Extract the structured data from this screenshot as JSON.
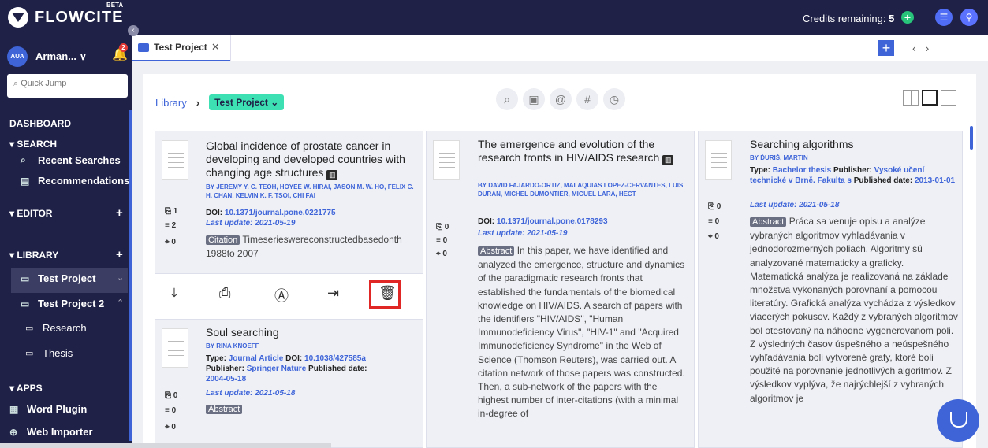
{
  "topbar": {
    "logo": "FLOWCITE",
    "beta": "BETA",
    "credits_label": "Credits remaining:",
    "credits_value": "5"
  },
  "sidebar": {
    "avatar": "AUA",
    "user": "Arman... ∨",
    "notifications": "2",
    "quick_jump": "Quick Jump",
    "dashboard": "DASHBOARD",
    "search": "▾ SEARCH",
    "recent_searches": "Recent Searches",
    "recommendations": "Recommendations",
    "editor": "▾ EDITOR",
    "library": "▾ LIBRARY",
    "project1": "Test Project",
    "project2": "Test Project 2",
    "research": "Research",
    "thesis": "Thesis",
    "apps": "▾ APPS",
    "word_plugin": "Word Plugin",
    "web_importer": "Web Importer"
  },
  "tabs": {
    "active": "Test Project"
  },
  "breadcrumb": {
    "library": "Library",
    "project": "Test Project ⌄"
  },
  "cards": [
    {
      "title": "Global incidence of prostate cancer in developing and developed countries with changing age structures",
      "authors": "BY JEREMY Y. C. TEOH, HOYEE W. HIRAI, JASON M. W. HO, FELIX C. H. CHAN, KELVIN K. F. TSOI, CHI FAI",
      "doi_label": "DOI:",
      "doi": "10.1371/journal.pone.0221775",
      "update": "Last update: 2021-05-19",
      "tag": "Citation",
      "body": "Timeserieswereconstructedbasedonth 1988to 2007",
      "stat1": "1",
      "stat2": "2",
      "stat3": "0"
    },
    {
      "title": "Soul searching",
      "authors": "BY RINA KNOEFF",
      "type_label": "Type:",
      "type": "Journal Article",
      "doi_label": "DOI:",
      "doi": "10.1038/427585a",
      "publisher_label": "Publisher:",
      "publisher": "Springer Nature",
      "pub_date_label": "Published date:",
      "pub_date": "2004-05-18",
      "update": "Last update: 2021-05-18",
      "tag": "Abstract",
      "stat1": "0",
      "stat2": "0",
      "stat3": "0"
    },
    {
      "title": "The emergence and evolution of the research fronts in HIV/AIDS research",
      "authors": "BY DAVID FAJARDO-ORTIZ, MALAQUIAS LOPEZ-CERVANTES, LUIS DURAN, MICHEL DUMONTIER, MIGUEL LARA, HECT",
      "doi_label": "DOI:",
      "doi": "10.1371/journal.pone.0178293",
      "update": "Last update: 2021-05-19",
      "tag": "Abstract",
      "body": "In this paper, we have identified and analyzed the emergence, structure and dynamics of the paradigmatic research fronts that established the fundamentals of the biomedical knowledge on HIV/AIDS. A search of papers with the identifiers \"HIV/AIDS\", \"Human Immunodeficiency Virus\", \"HIV-1\" and \"Acquired Immunodeficiency Syndrome\" in the Web of Science (Thomson Reuters), was carried out. A citation network of those papers was constructed. Then, a sub-network of the papers with the highest number of inter-citations (with a minimal in-degree of",
      "stat1": "0",
      "stat2": "0",
      "stat3": "0"
    },
    {
      "title": "Searching algorithms",
      "authors": "BY ĎURIŠ, MARTIN",
      "type_label": "Type:",
      "type": "Bachelor thesis",
      "publisher_label": "Publisher:",
      "publisher": "Vysoké učení technické v Brně. Fakulta s",
      "pub_date_label": "Published date:",
      "pub_date": "2013-01-01",
      "update": "Last update: 2021-05-18",
      "tag": "Abstract",
      "body": "Práca sa venuje opisu a analýze vybraných algoritmov vyhľadávania v jednodorozmerných poliach. Algoritmy sú analyzované matematicky a graficky. Matematická analýza je realizovaná na základe množstva vykonaných porovnaní a pomocou literatúry. Grafická analýza vychádza z výsledkov viacerých pokusov. Každý z vybraných algoritmov bol otestovaný na náhodne vygenerovanom poli. Z výsledných časov úspešného a neúspešného vyhľadávania boli vytvorené grafy, ktoré boli použité na porovnanie jednotlivých algoritmov. Z výsledkov vyplýva, že najrýchlejší z vybraných algoritmov je",
      "stat1": "0",
      "stat2": "0",
      "stat3": "0"
    }
  ],
  "colors": {
    "nav": "#1f2147",
    "accent": "#3e64d8",
    "highlight": "#e12626",
    "project_pill": "#3de0b2"
  }
}
